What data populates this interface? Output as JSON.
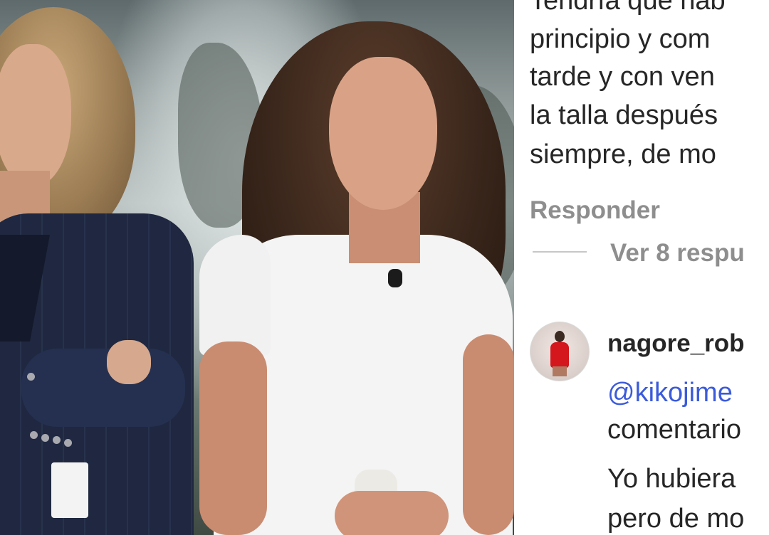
{
  "comment_thread": {
    "previous_comment_lines": [
      "Tendría que hab",
      "principio y com",
      "tarde y con ven",
      "la talla después",
      "siempre, de mo"
    ],
    "reply_label": "Responder",
    "view_replies_label": "Ver 8 respu",
    "reply": {
      "username": "nagore_rob",
      "mention": "@kikojime",
      "lines": [
        "comentario",
        "Yo hubiera",
        "pero de mo"
      ]
    }
  },
  "colors": {
    "text": "#262626",
    "secondary_text": "#8e8e8e",
    "mention": "#3b5bdb",
    "divider": "#c7c7c7"
  }
}
